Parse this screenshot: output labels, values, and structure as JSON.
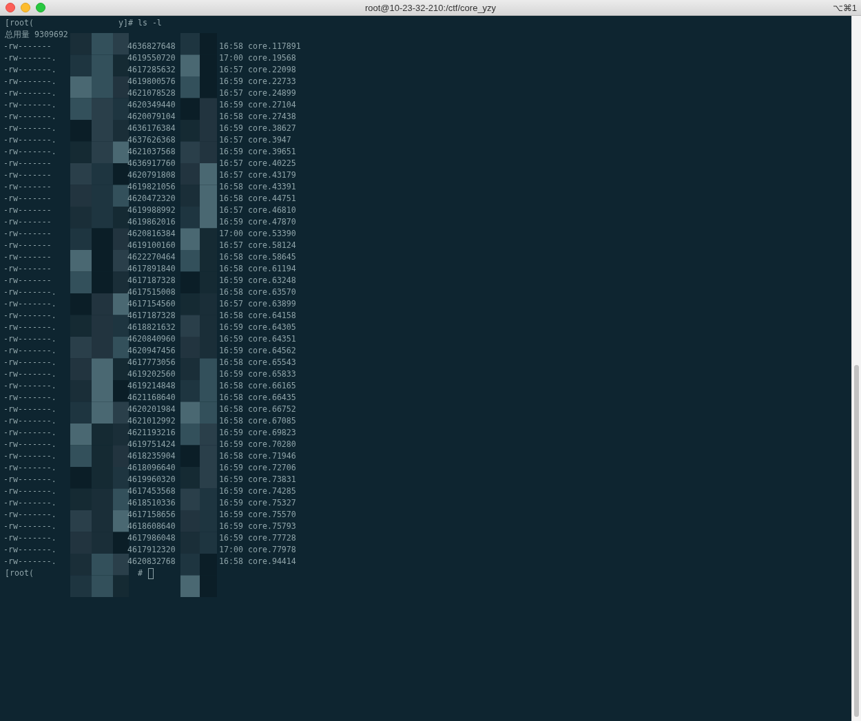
{
  "window": {
    "title": "root@10-23-32-210:/ctf/core_yzy",
    "shortcut": "⌥⌘1"
  },
  "terminal": {
    "command_line": {
      "prompt_start": "[root(",
      "prompt_end": "y]#",
      "command": "ls -l"
    },
    "total": "总用量 9309692",
    "files": [
      {
        "permissions": "-rw-------",
        "size": "4636827648",
        "time": "16:58",
        "name": "core.117891"
      },
      {
        "permissions": "-rw-------.",
        "size": "4619550720",
        "time": "17:00",
        "name": "core.19568"
      },
      {
        "permissions": "-rw-------.",
        "size": "4617285632",
        "time": "16:57",
        "name": "core.22098"
      },
      {
        "permissions": "-rw-------.",
        "size": "4619800576",
        "time": "16:59",
        "name": "core.22733"
      },
      {
        "permissions": "-rw-------.",
        "size": "4621078528",
        "time": "16:57",
        "name": "core.24899"
      },
      {
        "permissions": "-rw-------.",
        "size": "4620349440",
        "time": "16:59",
        "name": "core.27104"
      },
      {
        "permissions": "-rw-------.",
        "size": "4620079104",
        "time": "16:58",
        "name": "core.27438"
      },
      {
        "permissions": "-rw-------.",
        "size": "4636176384",
        "time": "16:59",
        "name": "core.38627"
      },
      {
        "permissions": "-rw-------.",
        "size": "4637626368",
        "time": "16:57",
        "name": "core.3947"
      },
      {
        "permissions": "-rw-------.",
        "size": "4621037568",
        "time": "16:59",
        "name": "core.39651"
      },
      {
        "permissions": "-rw-------",
        "size": "4636917760",
        "time": "16:57",
        "name": "core.40225"
      },
      {
        "permissions": "-rw-------",
        "size": "4620791808",
        "time": "16:57",
        "name": "core.43179"
      },
      {
        "permissions": "-rw-------",
        "size": "4619821056",
        "time": "16:58",
        "name": "core.43391"
      },
      {
        "permissions": "-rw-------",
        "size": "4620472320",
        "time": "16:58",
        "name": "core.44751"
      },
      {
        "permissions": "-rw-------",
        "size": "4619988992",
        "time": "16:57",
        "name": "core.46810"
      },
      {
        "permissions": "-rw-------",
        "size": "4619862016",
        "time": "16:59",
        "name": "core.47870"
      },
      {
        "permissions": "-rw-------",
        "size": "4620816384",
        "time": "17:00",
        "name": "core.53390"
      },
      {
        "permissions": "-rw-------",
        "size": "4619100160",
        "time": "16:57",
        "name": "core.58124"
      },
      {
        "permissions": "-rw-------",
        "size": "4622270464",
        "time": "16:58",
        "name": "core.58645"
      },
      {
        "permissions": "-rw-------",
        "size": "4617891840",
        "time": "16:58",
        "name": "core.61194"
      },
      {
        "permissions": "-rw-------",
        "size": "4617187328",
        "time": "16:59",
        "name": "core.63248"
      },
      {
        "permissions": "-rw-------.",
        "size": "4617515008",
        "time": "16:58",
        "name": "core.63570"
      },
      {
        "permissions": "-rw-------.",
        "size": "4617154560",
        "time": "16:57",
        "name": "core.63899"
      },
      {
        "permissions": "-rw-------.",
        "size": "4617187328",
        "time": "16:58",
        "name": "core.64158"
      },
      {
        "permissions": "-rw-------.",
        "size": "4618821632",
        "time": "16:59",
        "name": "core.64305"
      },
      {
        "permissions": "-rw-------.",
        "size": "4620840960",
        "time": "16:59",
        "name": "core.64351"
      },
      {
        "permissions": "-rw-------.",
        "size": "4620947456",
        "time": "16:59",
        "name": "core.64562"
      },
      {
        "permissions": "-rw-------.",
        "size": "4617773056",
        "time": "16:58",
        "name": "core.65543"
      },
      {
        "permissions": "-rw-------.",
        "size": "4619202560",
        "time": "16:59",
        "name": "core.65833"
      },
      {
        "permissions": "-rw-------.",
        "size": "4619214848",
        "time": "16:58",
        "name": "core.66165"
      },
      {
        "permissions": "-rw-------.",
        "size": "4621168640",
        "time": "16:58",
        "name": "core.66435"
      },
      {
        "permissions": "-rw-------.",
        "size": "4620201984",
        "time": "16:58",
        "name": "core.66752"
      },
      {
        "permissions": "-rw-------.",
        "size": "4621012992",
        "time": "16:58",
        "name": "core.67085"
      },
      {
        "permissions": "-rw-------.",
        "size": "4621193216",
        "time": "16:59",
        "name": "core.69823"
      },
      {
        "permissions": "-rw-------.",
        "size": "4619751424",
        "time": "16:59",
        "name": "core.70280"
      },
      {
        "permissions": "-rw-------.",
        "size": "4618235904",
        "time": "16:58",
        "name": "core.71946"
      },
      {
        "permissions": "-rw-------.",
        "size": "4618096640",
        "time": "16:59",
        "name": "core.72706"
      },
      {
        "permissions": "-rw-------.",
        "size": "4619960320",
        "time": "16:59",
        "name": "core.73831"
      },
      {
        "permissions": "-rw-------.",
        "size": "4617453568",
        "time": "16:59",
        "name": "core.74285"
      },
      {
        "permissions": "-rw-------.",
        "size": "4618510336",
        "time": "16:59",
        "name": "core.75327"
      },
      {
        "permissions": "-rw-------.",
        "size": "4617158656",
        "time": "16:59",
        "name": "core.75570"
      },
      {
        "permissions": "-rw-------.",
        "size": "4618608640",
        "time": "16:59",
        "name": "core.75793"
      },
      {
        "permissions": "-rw-------.",
        "size": "4617986048",
        "time": "16:59",
        "name": "core.77728"
      },
      {
        "permissions": "-rw-------.",
        "size": "4617912320",
        "time": "17:00",
        "name": "core.77978"
      },
      {
        "permissions": "-rw-------.",
        "size": "4620832768",
        "time": "16:58",
        "name": "core.94414"
      }
    ],
    "last_prompt": {
      "prompt_start": "[root(",
      "prompt_end": "#"
    }
  }
}
